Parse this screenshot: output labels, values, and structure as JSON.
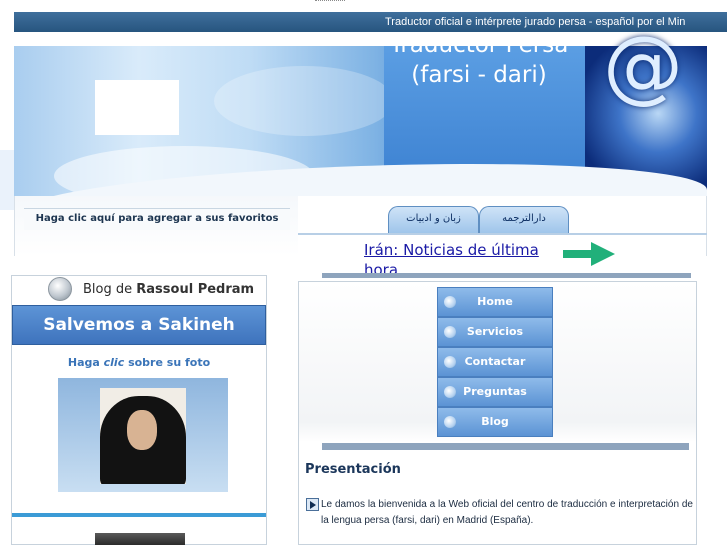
{
  "marquee": {
    "text": "Traductor oficial e intérprete jurado persa - español por el Min"
  },
  "banner": {
    "title": "Traductor Persa (farsi - dari)",
    "at_symbol": "@"
  },
  "favorites": {
    "label": "Haga clic aquí para agregar a sus favoritos"
  },
  "tabs": [
    {
      "label": "دارالترجمه"
    },
    {
      "label": "زبان و ادبیات"
    }
  ],
  "news": {
    "link": "Irán: Noticias de última hora"
  },
  "sidebar": {
    "blog_prefix": "Blog de",
    "blog_name": "Rassoul Pedram",
    "campaign": "Salvemos a Sakineh",
    "caption_pre": "Haga",
    "caption_em": "clic",
    "caption_post": "sobre su foto"
  },
  "nav": {
    "items": [
      {
        "label": "Home"
      },
      {
        "label": "Servicios"
      },
      {
        "label": "Contactar"
      },
      {
        "label": "Preguntas"
      },
      {
        "label": "Blog"
      }
    ]
  },
  "presentation": {
    "heading": "Presentación",
    "text": "Le damos la bienvenida a la Web oficial del centro de  traducción e interpretación de la lengua persa (farsi, dari) en Madrid (España)."
  },
  "colors": {
    "marquee_bg": "#2e5e8c",
    "nav_blue": "#5b93d4",
    "link_blue": "#1a1aa6",
    "accent_green": "#21b07a"
  }
}
